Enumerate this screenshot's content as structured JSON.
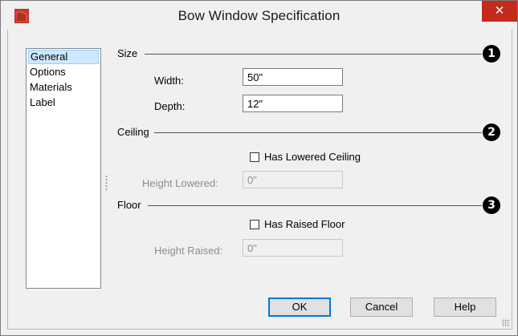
{
  "window": {
    "title": "Bow Window Specification",
    "close_glyph": "✕",
    "accent_color": "#c42b1c",
    "app_icon": "app-logo-icon"
  },
  "sidebar": {
    "items": [
      {
        "label": "General",
        "selected": true
      },
      {
        "label": "Options",
        "selected": false
      },
      {
        "label": "Materials",
        "selected": false
      },
      {
        "label": "Label",
        "selected": false
      }
    ]
  },
  "size_group": {
    "title": "Size",
    "badge": "1",
    "width_label": "Width:",
    "width_value": "50\"",
    "depth_label": "Depth:",
    "depth_value": "12\""
  },
  "ceiling_group": {
    "title": "Ceiling",
    "badge": "2",
    "checkbox_label": "Has Lowered Ceiling",
    "checked": false,
    "height_label": "Height Lowered:",
    "height_value": "0\""
  },
  "floor_group": {
    "title": "Floor",
    "badge": "3",
    "checkbox_label": "Has Raised Floor",
    "checked": false,
    "height_label": "Height Raised:",
    "height_value": "0\""
  },
  "buttons": {
    "ok": "OK",
    "cancel": "Cancel",
    "help": "Help"
  }
}
